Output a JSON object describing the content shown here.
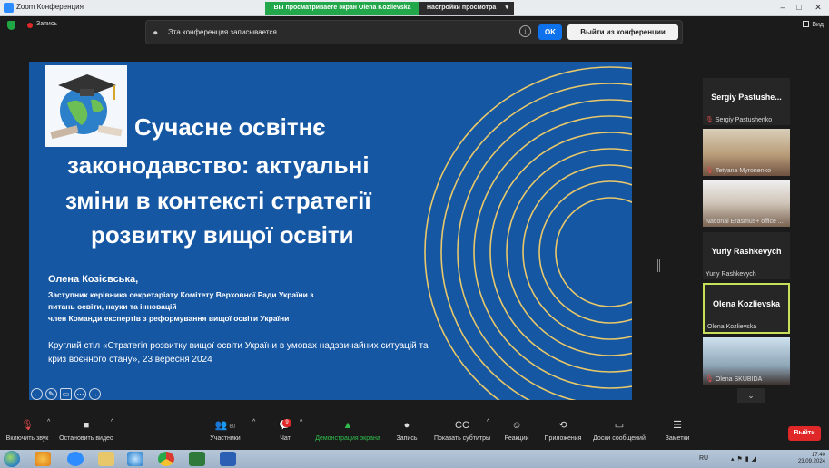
{
  "titlebar": {
    "app_title": "Zoom Конференция",
    "share_banner": "Вы просматриваете экран Olena Kozlievska",
    "view_settings": "Настройки просмотра",
    "min": "–",
    "max": "□",
    "close": "✕"
  },
  "recbar": {
    "rec_label": "Запись",
    "view_label": "Вид"
  },
  "notice": {
    "message": "Эта конференция записывается.",
    "info": "i",
    "ok": "OK",
    "leave": "Выйти из конференции"
  },
  "slide": {
    "title_lines": [
      "Сучасне освітнє",
      "законодавство: актуальні",
      "зміни в контексті стратегії",
      "розвитку вищої освіти"
    ],
    "author": "Олена Козієвська,",
    "roles": [
      "Заступник керівника секретаріату Комітету Верховної Ради України з",
      "питань освіти, науки та інновацій",
      "член Команди експертів з реформування вищої освіти України"
    ],
    "event_lines": [
      "Круглий стіл «Стратегія розвитку вищої освіти України в умовах надзвичайних ситуацій та",
      "криз воєнного стану», 23 вересня 2024"
    ],
    "tools": [
      "←",
      "✎",
      "▭",
      "⋯",
      "→"
    ]
  },
  "participants": [
    {
      "big_name": "Sergiy Pastushe...",
      "tag": "Sergiy Pastushenko",
      "video": false
    },
    {
      "big_name": "",
      "tag": "Tetyana Myronenko",
      "video": "a"
    },
    {
      "big_name": "",
      "tag": "National Erasmus+ office ...",
      "video": "b"
    },
    {
      "big_name": "Yuriy Rashkevych",
      "tag": "Yuriy Rashkevych",
      "video": false
    },
    {
      "big_name": "Olena Kozlievska",
      "tag": "Olena Kozlievska",
      "video": false
    },
    {
      "big_name": "",
      "tag": "Olena SKUBIDA",
      "video": "c"
    }
  ],
  "panel": {
    "more": "⌄"
  },
  "toolbar": {
    "mute": "Включить звук",
    "video": "Остановить видео",
    "participants": "Участники",
    "participants_count": "60",
    "chat": "Чат",
    "chat_badge": "9",
    "share": "Демонстрация экрана",
    "record": "Запись",
    "subtitles": "Показать субтитры",
    "reactions": "Реакции",
    "apps": "Приложения",
    "whiteboards": "Доски сообщений",
    "notes": "Заметки",
    "end": "Выйти"
  },
  "taskbar": {
    "lang": "RU",
    "time": "17:40",
    "date": "23.09.2024"
  },
  "colors": {
    "slide_bg": "#1657a3",
    "rings": "#e8c86a",
    "accent_blue": "#0e72ed",
    "share_green": "#22a84a",
    "end_red": "#e02828",
    "active_speaker": "#c6e05a"
  }
}
